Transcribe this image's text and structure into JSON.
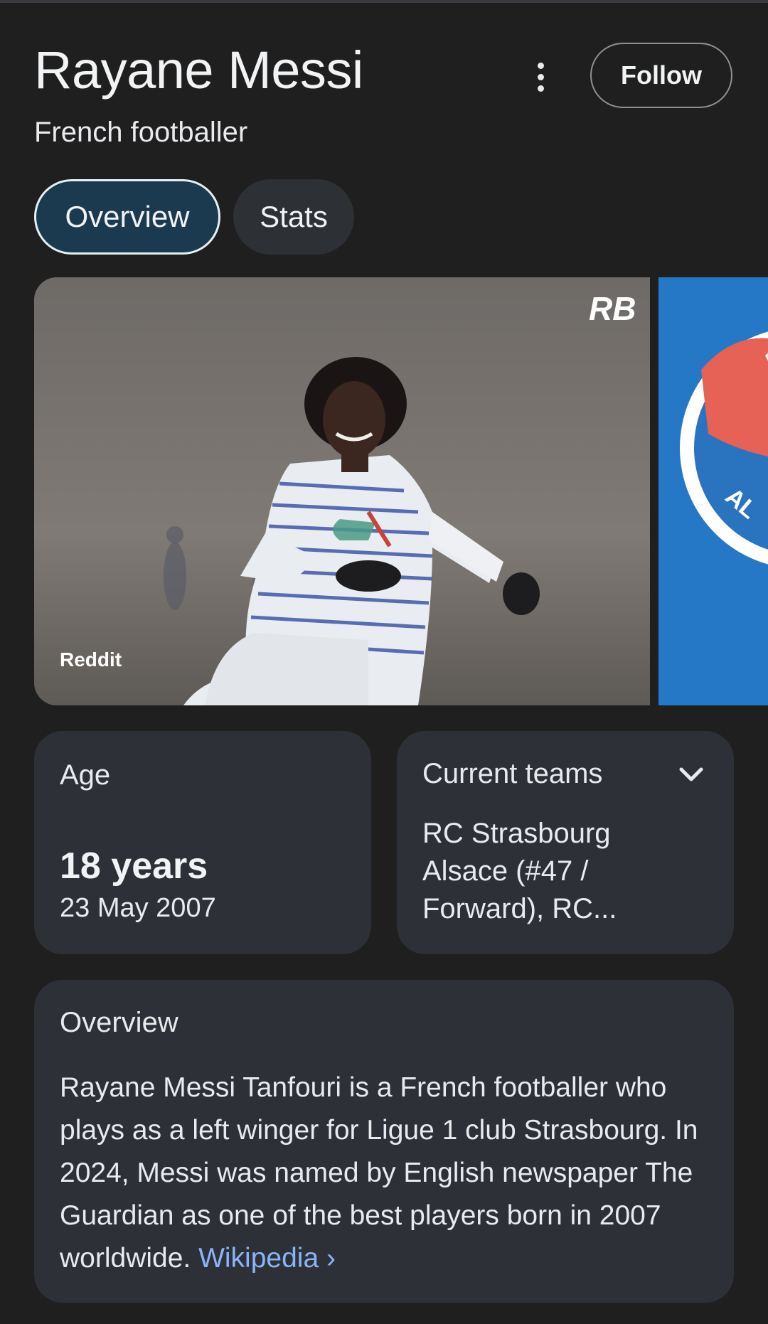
{
  "header": {
    "title": "Rayane Messi",
    "subtitle": "French footballer",
    "follow_label": "Follow"
  },
  "tabs": [
    {
      "label": "Overview",
      "selected": true
    },
    {
      "label": "Stats",
      "selected": false
    }
  ],
  "images": {
    "primary_source": "Reddit",
    "watermark": "RB",
    "badge_text": "AL"
  },
  "age_card": {
    "label": "Age",
    "value": "18 years",
    "birth_date": "23 May 2007"
  },
  "teams_card": {
    "label": "Current teams",
    "value": "RC Strasbourg Alsace (#47 / Forward), RC..."
  },
  "overview_card": {
    "label": "Overview",
    "text": "Rayane Messi Tanfouri is a French footballer who plays as a left winger for Ligue 1 club Strasbourg. In 2024, Messi was named by English newspaper The Guardian as one of the best players born in 2007 worldwide. ",
    "link_label": "Wikipedia",
    "link_chevron": "›"
  },
  "colors": {
    "background": "#1f1f1f",
    "card": "#2d3036",
    "tab_selected": "#1b3a4f",
    "link": "#8ab4f8"
  }
}
